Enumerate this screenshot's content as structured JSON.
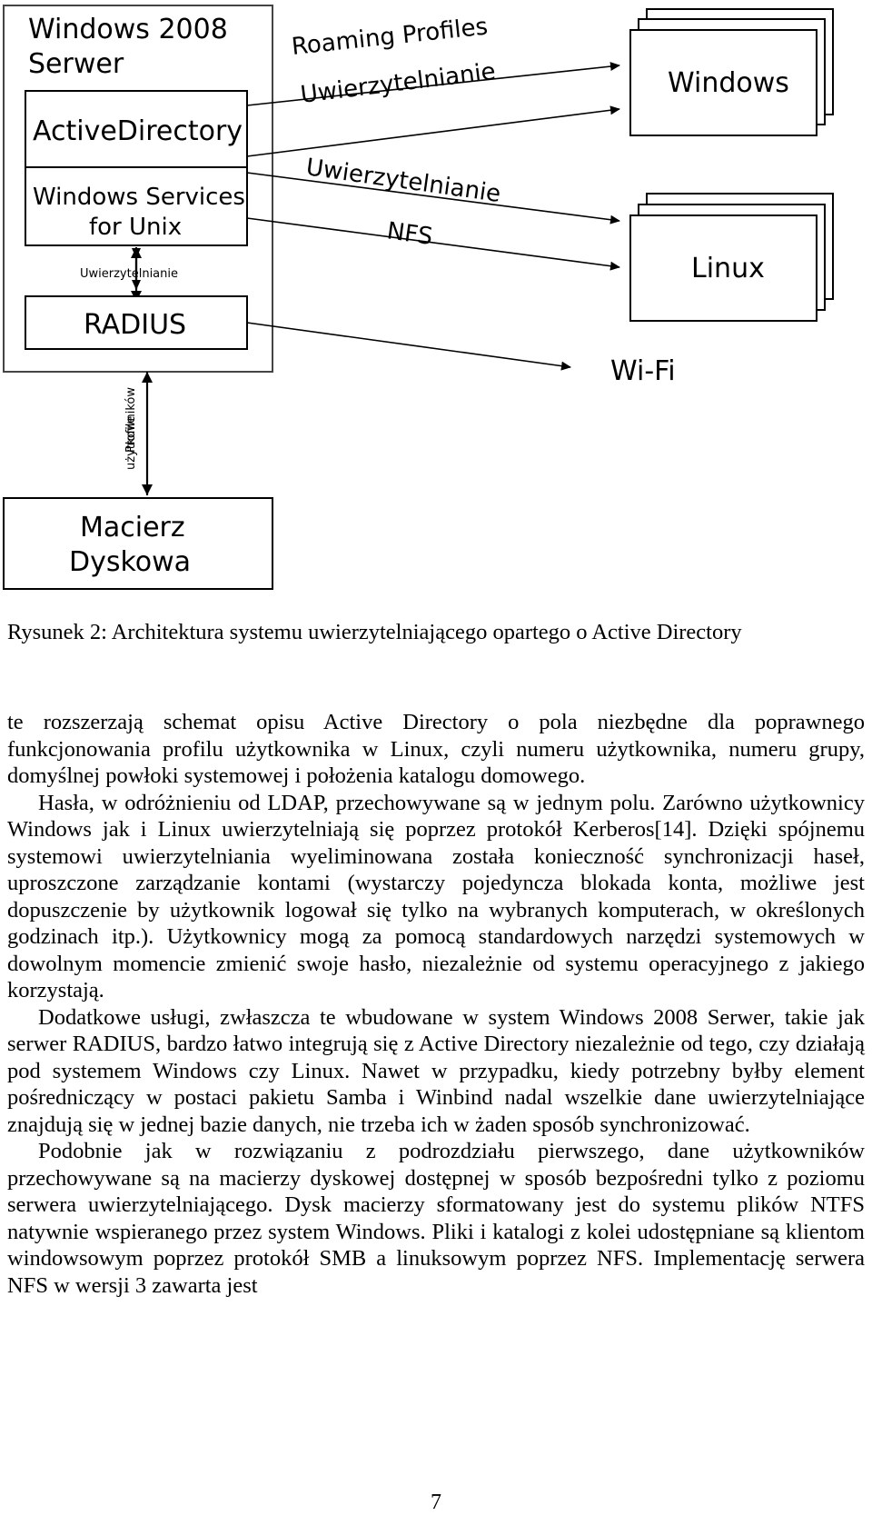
{
  "figure": {
    "server_container_label_line1": "Windows 2008",
    "server_container_label_line2": "Serwer",
    "boxes": {
      "active_directory": "ActiveDirectory",
      "wsu_line1": "Windows Services",
      "wsu_line2": "for Unix",
      "radius": "RADIUS",
      "storage_line1": "Macierz",
      "storage_line2": "Dyskowa",
      "windows_client": "Windows",
      "linux_client": "Linux",
      "wifi_client": "Wi-Fi"
    },
    "edge_labels": {
      "roaming_profiles": "Roaming Profiles",
      "uwierzytelnianie_windows": "Uwierzytelnianie",
      "uwierzytelnianie_linux": "Uwierzytelnianie",
      "nfs": "NFS",
      "uwierzytelnianie_radius": "Uwierzytelnianie",
      "profile_uzytkownikow_line1": "Profile",
      "profile_uzytkownikow_line2": "użytkowników"
    }
  },
  "caption": {
    "text": "Rysunek 2: Architektura systemu uwierzytelniającego opartego o Active Directory"
  },
  "body": {
    "para1": "te rozszerzają schemat opisu Active Directory o pola niezbędne dla poprawnego funkcjonowania profilu użytkownika w Linux, czyli numeru użytkownika, numeru grupy, domyślnej powłoki systemowej i położenia katalogu domowego.",
    "para2": "Hasła, w odróżnieniu od LDAP, przechowywane są w jednym polu. Zarówno użytkownicy Windows jak i Linux uwierzytelniają się poprzez protokół Kerberos[14]. Dzięki spójnemu systemowi uwierzytelniania wyeliminowana została konieczność synchronizacji haseł, uproszczone zarządzanie kontami (wystarczy pojedyncza blokada konta, możliwe jest dopuszczenie by użytkownik logował się tylko na wybranych komputerach, w określonych godzinach itp.). Użytkownicy mogą za pomocą standardowych narzędzi systemowych w dowolnym momencie zmienić swoje hasło, niezależnie od systemu operacyjnego z jakiego korzystają.",
    "para3": "Dodatkowe usługi, zwłaszcza te wbudowane w system Windows 2008 Serwer, takie jak serwer RADIUS, bardzo łatwo integrują się z Active Directory niezależnie od tego, czy działają pod systemem Windows czy Linux. Nawet w przypadku, kiedy potrzebny byłby element pośredniczący w postaci pakietu Samba i Winbind nadal wszelkie dane uwierzytelniające znajdują się w jednej bazie danych, nie trzeba ich w żaden sposób synchronizować.",
    "para4": "Podobnie jak w rozwiązaniu z podrozdziału pierwszego, dane użytkowników przechowywane są na macierzy dyskowej dostępnej w sposób bezpośredni tylko z poziomu serwera uwierzytelniającego. Dysk macierzy sformatowany jest do systemu plików NTFS natywnie wspieranego przez system Windows. Pliki i katalogi z kolei udostępniane są klientom windowsowym poprzez protokół SMB a linuksowym poprzez NFS. Implementację serwera NFS w wersji 3 zawarta jest"
  },
  "page_number": "7"
}
